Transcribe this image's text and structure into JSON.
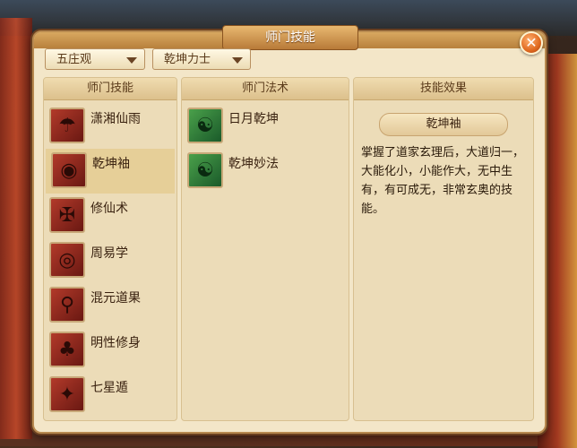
{
  "window": {
    "title": "师门技能",
    "close_label": "✕"
  },
  "filters": {
    "sect": "五庄观",
    "role": "乾坤力士"
  },
  "columns": {
    "skills_header": "师门技能",
    "spells_header": "师门法术",
    "effect_header": "技能效果"
  },
  "skills": [
    {
      "label": "潇湘仙雨",
      "icon": "rain-icon"
    },
    {
      "label": "乾坤袖",
      "icon": "sleeve-icon"
    },
    {
      "label": "修仙术",
      "icon": "cultivation-icon"
    },
    {
      "label": "周易学",
      "icon": "bagua-icon"
    },
    {
      "label": "混元道果",
      "icon": "fruit-icon"
    },
    {
      "label": "明性修身",
      "icon": "tree-icon"
    },
    {
      "label": "七星遁",
      "icon": "constellation-icon"
    }
  ],
  "selected_skill_index": 1,
  "spells": [
    {
      "label": "日月乾坤",
      "icon": "yin-yang-icon"
    },
    {
      "label": "乾坤妙法",
      "icon": "yin-yang-icon"
    }
  ],
  "effect": {
    "name": "乾坤袖",
    "description": "掌握了道家玄理后，大道归一，大能化小，小能作大，无中生有，有可成无，非常玄奥的技能。"
  },
  "colors": {
    "panel_bg": "#f3e6c8",
    "accent": "#e06a20",
    "skill_icon_red": "#b23a2a",
    "spell_icon_green": "#4aa04a"
  }
}
